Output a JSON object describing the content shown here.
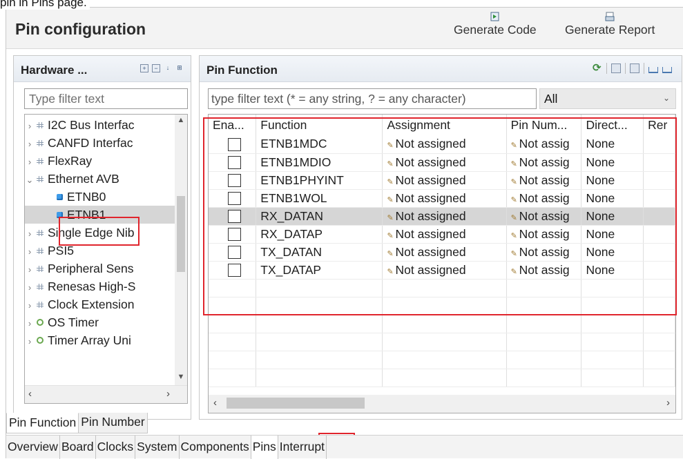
{
  "caption": "pin in Pins page.",
  "header": {
    "title": "Pin configuration",
    "generate_code": "Generate Code",
    "generate_report": "Generate Report"
  },
  "left": {
    "title": "Hardware ...",
    "filter_placeholder": "Type filter text",
    "tree": [
      {
        "label": "I2C Bus Interfac",
        "icon": "grid-icon",
        "expanded": false
      },
      {
        "label": "CANFD Interfac",
        "icon": "grid-icon",
        "expanded": false
      },
      {
        "label": "FlexRay",
        "icon": "grid-icon",
        "expanded": false
      },
      {
        "label": "Ethernet AVB",
        "icon": "grid-icon",
        "expanded": true
      },
      {
        "label": "ETNB0",
        "icon": "cube-icon",
        "child": true
      },
      {
        "label": "ETNB1",
        "icon": "cube-icon",
        "child": true,
        "selected": true
      },
      {
        "label": "Single Edge Nib",
        "icon": "grid-icon",
        "expanded": false
      },
      {
        "label": "PSI5",
        "icon": "grid-icon",
        "expanded": false
      },
      {
        "label": "Peripheral Sens",
        "icon": "grid-icon",
        "expanded": false
      },
      {
        "label": "Renesas High-S",
        "icon": "grid-icon",
        "expanded": false
      },
      {
        "label": "Clock Extension",
        "icon": "grid-icon",
        "expanded": false
      },
      {
        "label": "OS Timer",
        "icon": "timer-icon",
        "expanded": false
      },
      {
        "label": "Timer Array Uni",
        "icon": "timer-icon",
        "expanded": false
      }
    ]
  },
  "right": {
    "title": "Pin Function",
    "filter_placeholder": "type filter text (* = any string, ? = any character)",
    "select_value": "All",
    "columns": [
      "Ena...",
      "Function",
      "Assignment",
      "Pin Num...",
      "Direct...",
      "Rer"
    ],
    "rows": [
      {
        "function": "ETNB1MDC",
        "assignment": "Not assigned",
        "pin": "Not assig",
        "direction": "None"
      },
      {
        "function": "ETNB1MDIO",
        "assignment": "Not assigned",
        "pin": "Not assig",
        "direction": "None"
      },
      {
        "function": "ETNB1PHYINT",
        "assignment": "Not assigned",
        "pin": "Not assig",
        "direction": "None"
      },
      {
        "function": "ETNB1WOL",
        "assignment": "Not assigned",
        "pin": "Not assig",
        "direction": "None"
      },
      {
        "function": "RX_DATAN",
        "assignment": "Not assigned",
        "pin": "Not assig",
        "direction": "None",
        "selected": true
      },
      {
        "function": "RX_DATAP",
        "assignment": "Not assigned",
        "pin": "Not assig",
        "direction": "None"
      },
      {
        "function": "TX_DATAN",
        "assignment": "Not assigned",
        "pin": "Not assig",
        "direction": "None"
      },
      {
        "function": "TX_DATAP",
        "assignment": "Not assigned",
        "pin": "Not assig",
        "direction": "None"
      }
    ]
  },
  "subtabs": [
    "Pin Function",
    "Pin Number"
  ],
  "maintabs": [
    "Overview",
    "Board",
    "Clocks",
    "System",
    "Components",
    "Pins",
    "Interrupt"
  ],
  "colors": {
    "highlight": "#e0242c",
    "selection": "#d6d6d6"
  }
}
